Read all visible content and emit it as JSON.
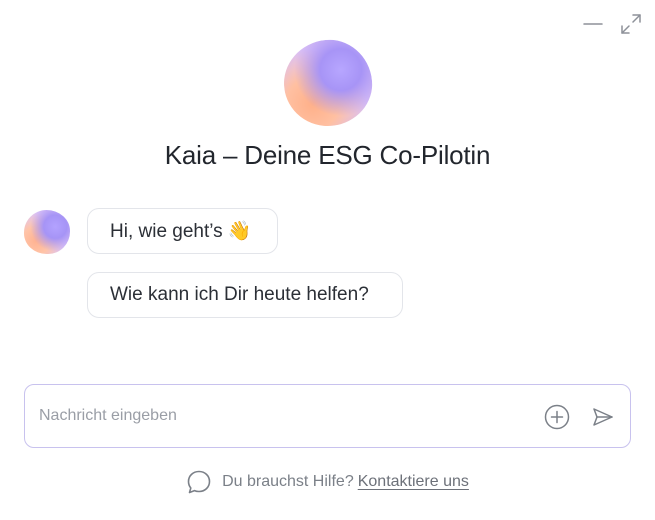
{
  "window_controls": {
    "minimize_icon": "minimize-icon",
    "expand_icon": "expand-icon"
  },
  "header": {
    "title": "Kaia – Deine ESG Co-Pilotin"
  },
  "messages": [
    {
      "text": "Hi, wie geht’s 👋"
    },
    {
      "text": "Wie kann ich Dir heute helfen?"
    }
  ],
  "composer": {
    "placeholder": "Nachricht eingeben",
    "value": "",
    "add_icon": "plus-circle-icon",
    "send_icon": "send-icon"
  },
  "footer": {
    "help_text": "Du brauchst Hilfe?",
    "link_text": "Kontaktiere uns",
    "icon": "chat-bubble-icon"
  },
  "colors": {
    "accent_border": "#c8c2ee",
    "avatar_purple": "#a794f6",
    "avatar_peach": "#ffb089",
    "text": "#2b2f36",
    "muted": "#7b8088"
  }
}
